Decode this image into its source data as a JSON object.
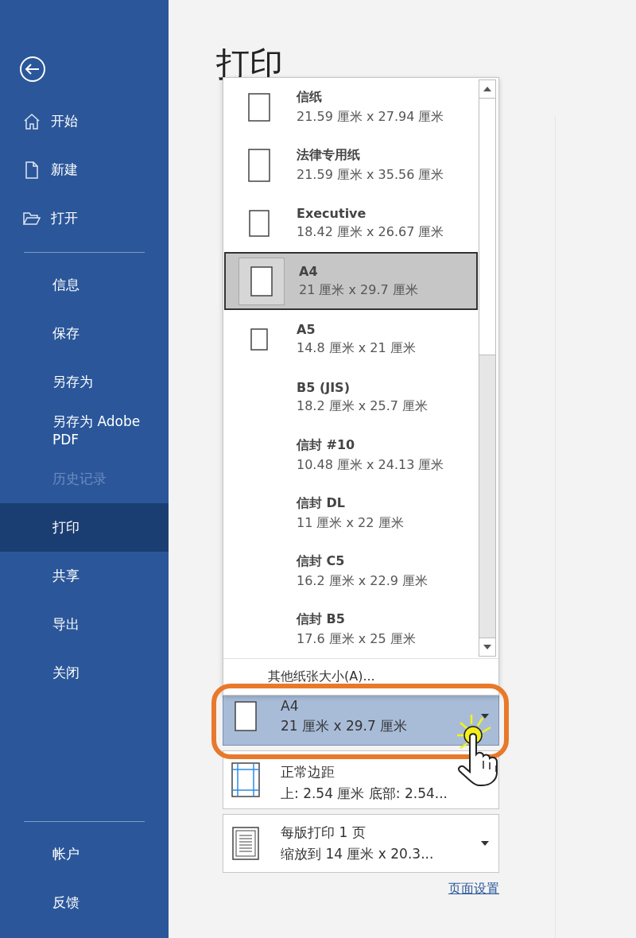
{
  "sidebar": {
    "top_items": [
      {
        "label": "开始",
        "kind": "home",
        "selected": false,
        "disabled": false
      },
      {
        "label": "新建",
        "kind": "new",
        "selected": false,
        "disabled": false
      },
      {
        "label": "打开",
        "kind": "open",
        "selected": false,
        "disabled": false
      }
    ],
    "middle_items": [
      {
        "label": "信息",
        "selected": false,
        "disabled": false
      },
      {
        "label": "保存",
        "selected": false,
        "disabled": false
      },
      {
        "label": "另存为",
        "selected": false,
        "disabled": false
      },
      {
        "label": "另存为 Adobe PDF",
        "selected": false,
        "disabled": false
      },
      {
        "label": "历史记录",
        "selected": false,
        "disabled": true
      },
      {
        "label": "打印",
        "selected": true,
        "disabled": false
      },
      {
        "label": "共享",
        "selected": false,
        "disabled": false
      },
      {
        "label": "导出",
        "selected": false,
        "disabled": false
      },
      {
        "label": "关闭",
        "selected": false,
        "disabled": false
      }
    ],
    "bottom_items": [
      {
        "label": "帐户",
        "selected": false,
        "disabled": false
      },
      {
        "label": "反馈",
        "selected": false,
        "disabled": false
      }
    ]
  },
  "page_title": "打印",
  "paper_size_menu": {
    "items": [
      {
        "name": "信纸",
        "size": "21.59 厘米 x 27.94 厘米",
        "kind": "letter",
        "selected": false
      },
      {
        "name": "法律专用纸",
        "size": "21.59 厘米 x 35.56 厘米",
        "kind": "legal",
        "selected": false
      },
      {
        "name": "Executive",
        "size": "18.42 厘米 x 26.67 厘米",
        "kind": "executive",
        "selected": false
      },
      {
        "name": "A4",
        "size": "21 厘米 x 29.7 厘米",
        "kind": "a4",
        "selected": true
      },
      {
        "name": "A5",
        "size": "14.8 厘米 x 21 厘米",
        "kind": "a5",
        "selected": false
      },
      {
        "name": "B5 (JIS)",
        "size": "18.2 厘米 x 25.7 厘米",
        "kind": "none",
        "selected": false
      },
      {
        "name": "信封 #10",
        "size": "10.48 厘米 x 24.13 厘米",
        "kind": "none",
        "selected": false
      },
      {
        "name": "信封 DL",
        "size": "11 厘米 x 22 厘米",
        "kind": "none",
        "selected": false
      },
      {
        "name": "信封 C5",
        "size": "16.2 厘米 x 22.9 厘米",
        "kind": "none",
        "selected": false
      },
      {
        "name": "信封 B5",
        "size": "17.6 厘米 x 25 厘米",
        "kind": "none",
        "selected": false
      }
    ],
    "more_sizes": "其他纸张大小(A)..."
  },
  "settings": [
    {
      "kind": "paper_size",
      "title": "A4",
      "detail": "21 厘米 x 29.7 厘米",
      "open": true
    },
    {
      "kind": "margins",
      "title": "正常边距",
      "detail": "上: 2.54 厘米 底部: 2.54...",
      "open": false
    },
    {
      "kind": "pages_per_sheet",
      "title": "每版打印 1 页",
      "detail": "缩放到 14 厘米 x 20.3...",
      "open": false
    }
  ],
  "page_setup_link": "页面设置"
}
